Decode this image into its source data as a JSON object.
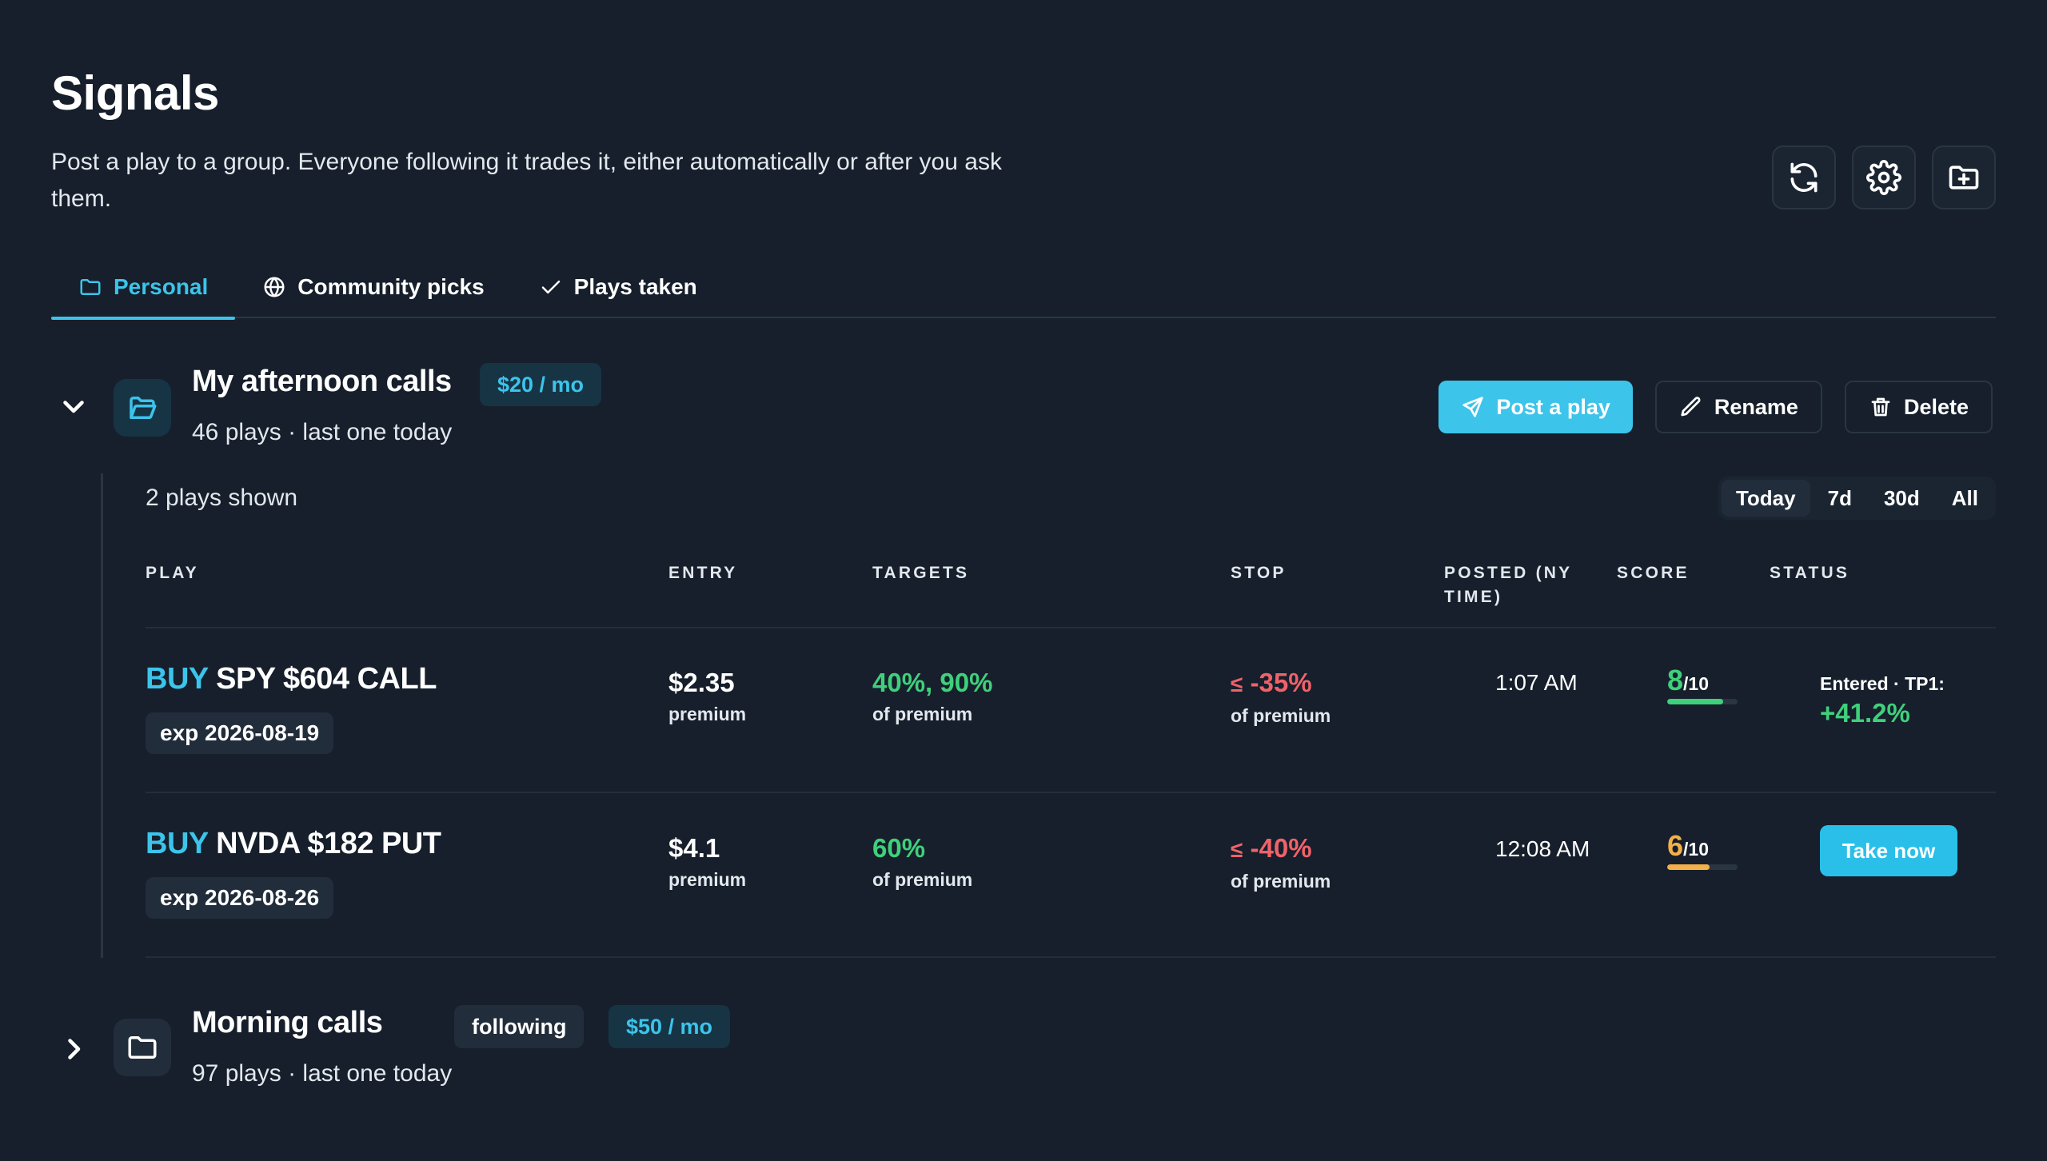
{
  "page": {
    "title": "Signals",
    "subtitle": "Post a play to a group. Everyone following it trades it, either automatically or after you ask them."
  },
  "header_icons": [
    "refresh-icon",
    "gear-icon",
    "folder-plus-icon"
  ],
  "tabs": [
    {
      "label": "Personal",
      "icon": "folder-icon",
      "active": true
    },
    {
      "label": "Community picks",
      "icon": "globe-icon",
      "active": false
    },
    {
      "label": "Plays taken",
      "icon": "check-icon",
      "active": false
    }
  ],
  "groups": [
    {
      "name": "My afternoon calls",
      "price": "$20 / mo",
      "meta": "46 plays · last one today",
      "expanded": true,
      "actions": {
        "post": "Post a play",
        "rename": "Rename",
        "delete": "Delete"
      },
      "plays_shown": "2 plays shown",
      "range_options": [
        "Today",
        "7d",
        "30d",
        "All"
      ],
      "range_selected": "Today",
      "columns": [
        "Play",
        "Entry",
        "Targets",
        "Stop",
        "Posted (NY time)",
        "Score",
        "Status"
      ],
      "plays": [
        {
          "side": "BUY",
          "contract": "SPY $604 CALL",
          "exp": "exp 2026-08-19",
          "entry": "$2.35",
          "entry_sub": "premium",
          "targets": "40%, 90%",
          "targets_sub": "of premium",
          "stop_prefix": "≤",
          "stop": "-35%",
          "stop_sub": "of premium",
          "posted": "1:07 AM",
          "score": "8",
          "score_den": "/10",
          "score_value": 8,
          "score_color": "#3fd07c",
          "status_label": "Entered · TP1:",
          "status_value": "+41.2%"
        },
        {
          "side": "BUY",
          "contract": "NVDA $182 PUT",
          "exp": "exp 2026-08-26",
          "entry": "$4.1",
          "entry_sub": "premium",
          "targets": "60%",
          "targets_sub": "of premium",
          "stop_prefix": "≤",
          "stop": "-40%",
          "stop_sub": "of premium",
          "posted": "12:08 AM",
          "score": "6",
          "score_den": "/10",
          "score_value": 6,
          "score_color": "#f3b04a",
          "status_action": "Take now"
        }
      ]
    },
    {
      "name": "Morning calls",
      "badge": "following",
      "price": "$50 / mo",
      "meta": "97 plays · last one today",
      "expanded": false
    }
  ],
  "colors": {
    "background": "#161f2b",
    "accent": "#3cc4ea",
    "positive": "#3fd07c",
    "negative": "#f0626a",
    "warning": "#f3b04a"
  }
}
